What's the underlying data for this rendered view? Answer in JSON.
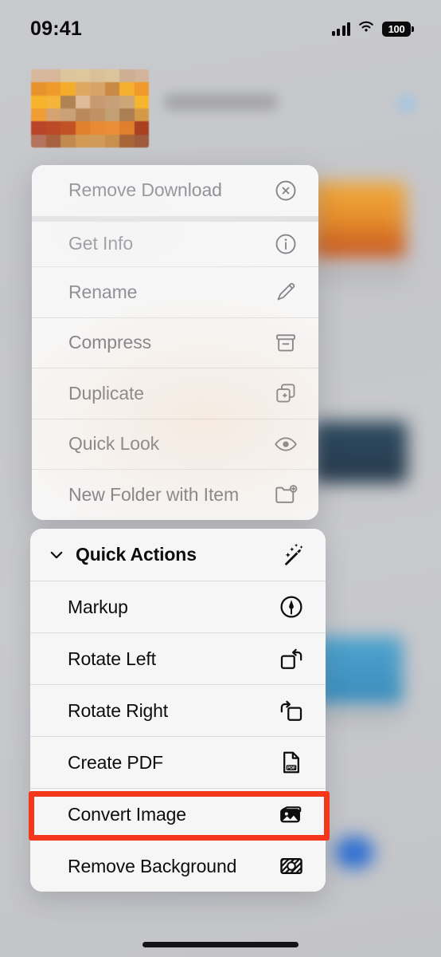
{
  "status_bar": {
    "time": "09:41",
    "signal_icon": "cellular-bars-icon",
    "wifi_icon": "wifi-icon",
    "battery_percent": "100",
    "battery_icon": "battery-full-icon"
  },
  "file_row": {
    "thumbnail_name": "file-thumbnail-pixelated",
    "thumbnail_colors": [
      "#d8b89c",
      "#d9b79a",
      "#dcc49c",
      "#ddc79b",
      "#d9c096",
      "#dbc49b",
      "#cdae92",
      "#d3b49a",
      "#e8912f",
      "#ef9b2c",
      "#f5ac2a",
      "#dfa860",
      "#d8a368",
      "#c98a45",
      "#f5b02f",
      "#ef9a2a",
      "#f7b32c",
      "#f4b53a",
      "#b08352",
      "#e0bb9a",
      "#c79a72",
      "#c7a07a",
      "#cba677",
      "#f5b52e",
      "#ef9d34",
      "#d5a271",
      "#caa178",
      "#b9895c",
      "#bf9163",
      "#c3a074",
      "#ab7f52",
      "#d59a47",
      "#b8452a",
      "#bc4a26",
      "#c05226",
      "#e0802c",
      "#e88b34",
      "#ea8f38",
      "#e07f2c",
      "#a8411f",
      "#b4735d",
      "#a9623f",
      "#c08a51",
      "#d29a55",
      "#d09b58",
      "#c98f4c",
      "#a8653a",
      "#a05a3c"
    ],
    "label_name": "file-name-blurred",
    "accessory_name": "file-accessory-blurred"
  },
  "context_menu": {
    "disabled_items": [
      {
        "label": "Remove Download",
        "icon": "remove-download-icon"
      },
      {
        "label": "Get Info",
        "icon": "info-circle-icon"
      },
      {
        "label": "Rename",
        "icon": "pencil-icon"
      },
      {
        "label": "Compress",
        "icon": "archivebox-icon"
      },
      {
        "label": "Duplicate",
        "icon": "duplicate-icon"
      },
      {
        "label": "Quick Look",
        "icon": "eye-icon"
      },
      {
        "label": "New Folder with Item",
        "icon": "folder-badge-plus-icon"
      }
    ]
  },
  "quick_actions": {
    "header": {
      "label": "Quick Actions",
      "chevron_icon": "chevron-down-icon",
      "icon": "wand-sparkles-icon"
    },
    "items": [
      {
        "label": "Markup",
        "icon": "markup-pen-circle-icon"
      },
      {
        "label": "Rotate Left",
        "icon": "rotate-left-icon"
      },
      {
        "label": "Rotate Right",
        "icon": "rotate-right-icon"
      },
      {
        "label": "Create PDF",
        "icon": "create-pdf-icon"
      },
      {
        "label": "Convert Image",
        "icon": "convert-image-icon"
      },
      {
        "label": "Remove Background",
        "icon": "remove-background-icon"
      }
    ]
  },
  "annotation": {
    "highlight_target": "Convert Image",
    "highlight_color": "#f4361a"
  },
  "home_indicator": {
    "name": "home-indicator"
  }
}
